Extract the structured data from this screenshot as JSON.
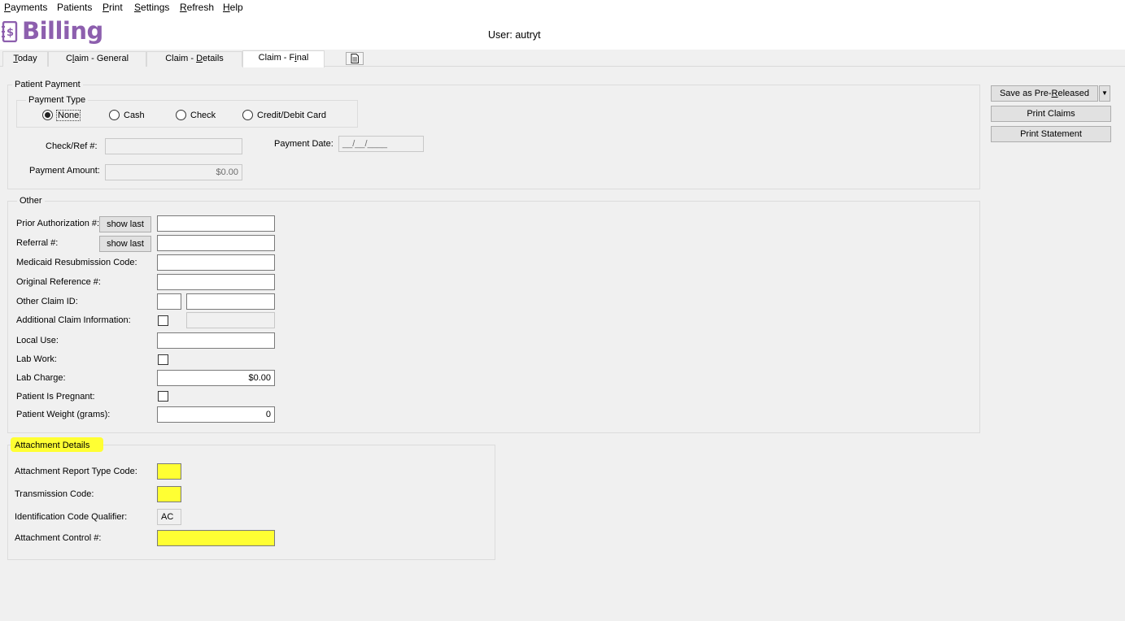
{
  "menu": [
    {
      "label": "Payments",
      "ul": "P",
      "rest": "ayments"
    },
    {
      "label": "Patients",
      "ul": "",
      "rest": "Patients"
    },
    {
      "label": "Print",
      "ul": "P",
      "rest": "rint"
    },
    {
      "label": "Settings",
      "ul": "S",
      "rest": "ettings"
    },
    {
      "label": "Refresh",
      "ul": "R",
      "rest": "efresh"
    },
    {
      "label": "Help",
      "ul": "H",
      "rest": "elp"
    }
  ],
  "app": {
    "logo_text": "Billing",
    "user_label": "User: autryt"
  },
  "tabs": {
    "today": {
      "ul": "T",
      "rest": "oday"
    },
    "general": {
      "pre": "C",
      "ul": "l",
      "rest": "aim - General"
    },
    "details": {
      "pre": "Claim - ",
      "ul": "D",
      "rest": "etails"
    },
    "final": {
      "pre": "Claim - F",
      "ul": "i",
      "rest": "nal"
    }
  },
  "patient_payment": {
    "title": "Patient Payment",
    "payment_type": {
      "title": "Payment Type",
      "options": [
        "None",
        "Cash",
        "Check",
        "Credit/Debit Card"
      ],
      "selected": "None"
    },
    "check_ref_label": "Check/Ref #:",
    "check_ref_value": "",
    "payment_date_label": "Payment Date:",
    "payment_date_value": "__/__/____",
    "payment_amount_label": "Payment Amount:",
    "payment_amount_value": "$0.00"
  },
  "other": {
    "title": "Other",
    "show_last": "show last",
    "prior_auth_label": "Prior Authorization #:",
    "referral_label": "Referral #:",
    "medicaid_label": "Medicaid Resubmission Code:",
    "original_ref_label": "Original Reference #:",
    "other_claim_label": "Other Claim ID:",
    "additional_claim_label": "Additional Claim Information:",
    "local_use_label": "Local Use:",
    "lab_work_label": "Lab Work:",
    "lab_charge_label": "Lab Charge:",
    "lab_charge_value": "$0.00",
    "pregnant_label": "Patient Is Pregnant:",
    "weight_label": "Patient Weight (grams):",
    "weight_value": "0"
  },
  "attachment": {
    "title": "Attachment Details",
    "report_type_label": "Attachment Report Type Code:",
    "transmission_label": "Transmission Code:",
    "qualifier_label": "Identification Code Qualifier:",
    "qualifier_value": "AC",
    "control_label": "Attachment Control #:"
  },
  "actions": {
    "save_prereleased": {
      "pre": "Save as Pre-",
      "ul": "R",
      "rest": "eleased"
    },
    "print_claims": "Print Claims",
    "print_statement": "Print Statement"
  },
  "colors": {
    "logo": "#8d5fae",
    "highlight": "#ffff33"
  }
}
